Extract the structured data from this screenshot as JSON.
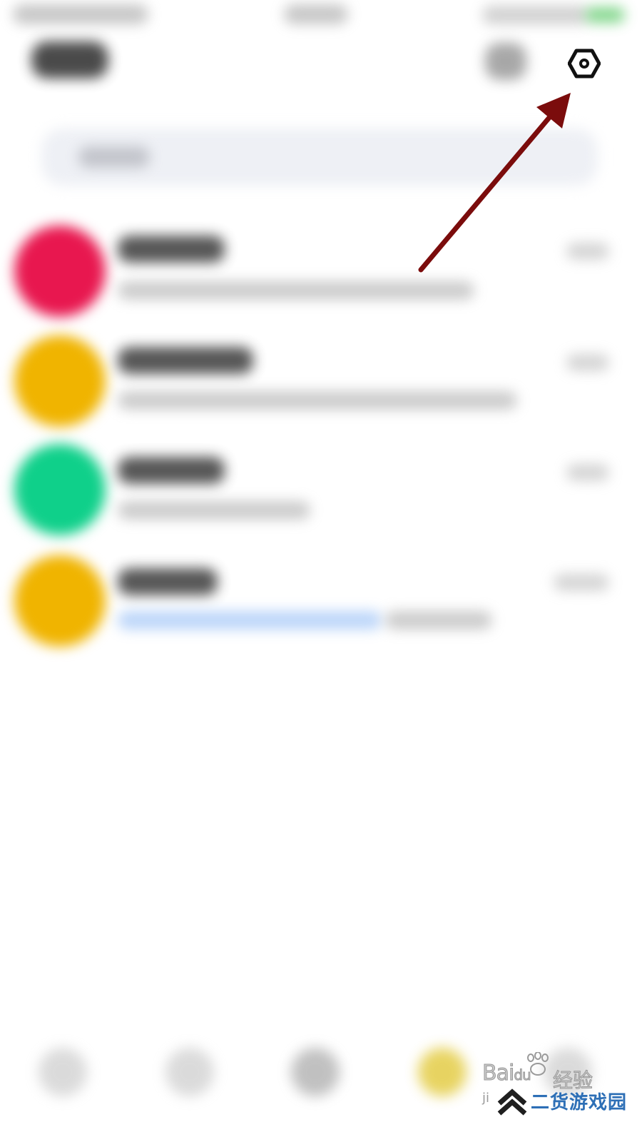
{
  "status_bar": {
    "battery_color": "#6fd07a"
  },
  "header": {
    "settings_icon": "settings-hexagon-icon"
  },
  "conversations": [
    {
      "avatar_color": "#e8174f"
    },
    {
      "avatar_color": "#f0b400"
    },
    {
      "avatar_color": "#0fd08a"
    },
    {
      "avatar_color": "#f0b400"
    }
  ],
  "annotation": {
    "arrow_color": "#7b0c0c",
    "points_to": "settings-button"
  },
  "tab_bar": {
    "active_tab_color": "#e2c93a"
  },
  "watermarks": {
    "baidu": "Bai",
    "baidu_suffix": "du",
    "jingyan": "经验",
    "site": "二货游戏园",
    "small": "ji"
  }
}
